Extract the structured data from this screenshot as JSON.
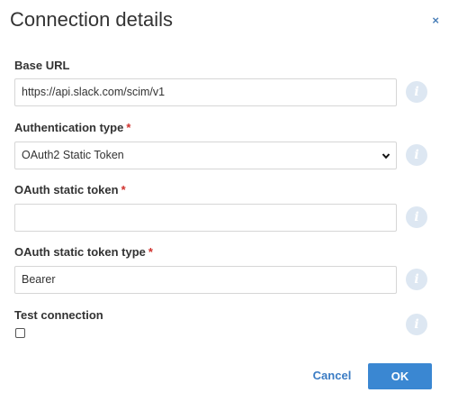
{
  "dialog": {
    "title": "Connection details",
    "close_label": "×"
  },
  "fields": {
    "base_url": {
      "label": "Base URL",
      "value": "https://api.slack.com/scim/v1"
    },
    "auth_type": {
      "label": "Authentication type",
      "required_mark": "*",
      "selected": "OAuth2 Static Token"
    },
    "oauth_token": {
      "label": "OAuth static token",
      "required_mark": "*",
      "value": ""
    },
    "oauth_token_type": {
      "label": "OAuth static token type",
      "required_mark": "*",
      "value": "Bearer"
    },
    "test_connection": {
      "label": "Test connection",
      "checked": false
    }
  },
  "info_glyph": "i",
  "icons": {
    "info": "info-icon",
    "close": "close-icon",
    "dropdown": "chevron-down-icon"
  },
  "colors": {
    "accent": "#3a87d2",
    "required": "#d0312d",
    "info_bg": "#dde7f2"
  },
  "buttons": {
    "cancel": "Cancel",
    "ok": "OK"
  }
}
